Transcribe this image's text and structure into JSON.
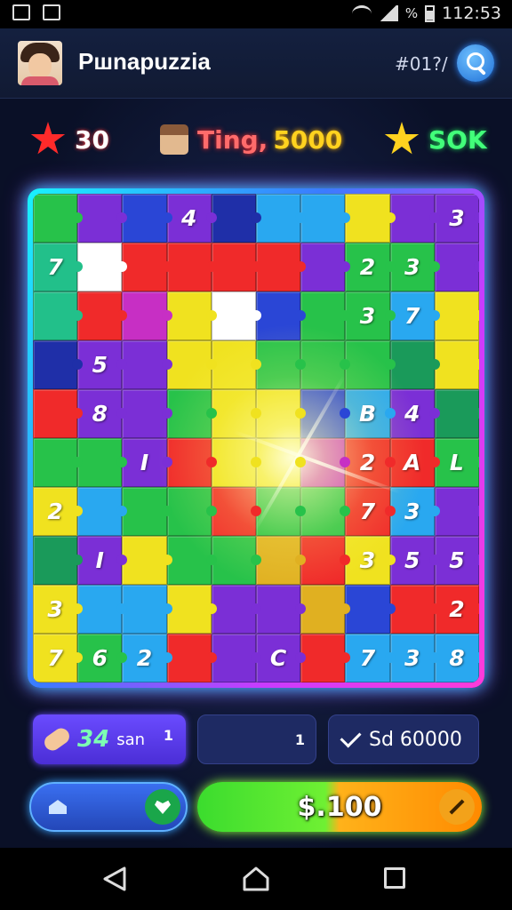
{
  "status_bar": {
    "time": "112:53",
    "battery_label": "%"
  },
  "header": {
    "title": "Pшnapuzzia",
    "code": "#01?/",
    "avatar": "avatar",
    "search": "search-icon"
  },
  "stats": [
    {
      "icon": "red-star-icon",
      "value": "30"
    },
    {
      "icon": "character-icon",
      "label": "Ting,",
      "value": "5000"
    },
    {
      "icon": "gold-star-icon",
      "value": "SOK"
    }
  ],
  "board": {
    "columns": 10,
    "rows": 10,
    "tiles": [
      [
        "#27c24a",
        "#7b2fd6",
        "#2a46d6",
        "#7b2fd6",
        "#1f2fa8",
        "#29a8f0",
        "#29a8f0",
        "#f0e21f",
        "#7b2fd6",
        "#7b2fd6"
      ],
      [
        "#22c08a",
        "#ffffff",
        "#f02a2a",
        "#f02a2a",
        "#f02a2a",
        "#f02a2a",
        "#7b2fd6",
        "#27c24a",
        "#27c24a",
        "#7b2fd6"
      ],
      [
        "#22c08a",
        "#f02a2a",
        "#c72fc4",
        "#f0e21f",
        "#ffffff",
        "#2a46d6",
        "#27c24a",
        "#27c24a",
        "#29a8f0",
        "#f0e21f"
      ],
      [
        "#1f2fa8",
        "#7b2fd6",
        "#7b2fd6",
        "#f0e21f",
        "#f0e21f",
        "#27c24a",
        "#27c24a",
        "#27c24a",
        "#1a9a5a",
        "#f0e21f"
      ],
      [
        "#f02a2a",
        "#7b2fd6",
        "#7b2fd6",
        "#27c24a",
        "#f0e21f",
        "#f0e21f",
        "#2a46d6",
        "#29a8f0",
        "#7b2fd6",
        "#1a9a5a"
      ],
      [
        "#27c24a",
        "#27c24a",
        "#7b2fd6",
        "#f02a2a",
        "#f0e21f",
        "#f0e21f",
        "#c72fc4",
        "#f02a2a",
        "#f02a2a",
        "#27c24a"
      ],
      [
        "#f0e21f",
        "#29a8f0",
        "#27c24a",
        "#27c24a",
        "#f02a2a",
        "#27c24a",
        "#27c24a",
        "#f02a2a",
        "#29a8f0",
        "#7b2fd6"
      ],
      [
        "#1a9a5a",
        "#7b2fd6",
        "#f0e21f",
        "#27c24a",
        "#27c24a",
        "#e0b021",
        "#f02a2a",
        "#f0e21f",
        "#7b2fd6",
        "#7b2fd6"
      ],
      [
        "#f0e21f",
        "#29a8f0",
        "#29a8f0",
        "#f0e21f",
        "#7b2fd6",
        "#7b2fd6",
        "#e0b021",
        "#2a46d6",
        "#f02a2a",
        "#f02a2a"
      ],
      [
        "#f0e21f",
        "#27c24a",
        "#29a8f0",
        "#f02a2a",
        "#7b2fd6",
        "#7b2fd6",
        "#f02a2a",
        "#29a8f0",
        "#29a8f0",
        "#29a8f0"
      ]
    ],
    "numbers": [
      [
        "",
        "",
        "",
        "4",
        "",
        "",
        "",
        "",
        "",
        "3"
      ],
      [
        "7",
        "",
        "",
        "",
        "",
        "",
        "",
        "2",
        "3",
        ""
      ],
      [
        "",
        "",
        "",
        "",
        "",
        "",
        "",
        "3",
        "7",
        ""
      ],
      [
        "",
        "5",
        "",
        "",
        "",
        "",
        "",
        "",
        "",
        ""
      ],
      [
        "",
        "8",
        "",
        "",
        "",
        "",
        "",
        "B",
        "4",
        ""
      ],
      [
        "",
        "",
        "I",
        "",
        "",
        "",
        "",
        "2",
        "A",
        "L"
      ],
      [
        "2",
        "",
        "",
        "",
        "",
        "",
        "",
        "7",
        "3",
        ""
      ],
      [
        "",
        "I",
        "",
        "",
        "",
        "",
        "",
        "3",
        "5",
        "5"
      ],
      [
        "3",
        "",
        "",
        "",
        "",
        "",
        "",
        "",
        "",
        "2"
      ],
      [
        "7",
        "6",
        "2",
        "",
        "",
        "C",
        "",
        "7",
        "3",
        "8"
      ]
    ]
  },
  "buttons": {
    "hint": {
      "value": "34",
      "sub": "san",
      "count": "1",
      "icon": "bandage-icon"
    },
    "middle": {
      "count": "1"
    },
    "sd": {
      "label": "Sd 60000",
      "icon": "check-icon"
    },
    "home": {
      "icon": "home-icon",
      "badge": "heart-icon"
    },
    "score": {
      "label": "$.100",
      "badge": "pencil-icon"
    }
  },
  "colors": {
    "accent_cyan": "#19f2ff",
    "accent_magenta": "#c93bff",
    "background": "#0b1024"
  }
}
